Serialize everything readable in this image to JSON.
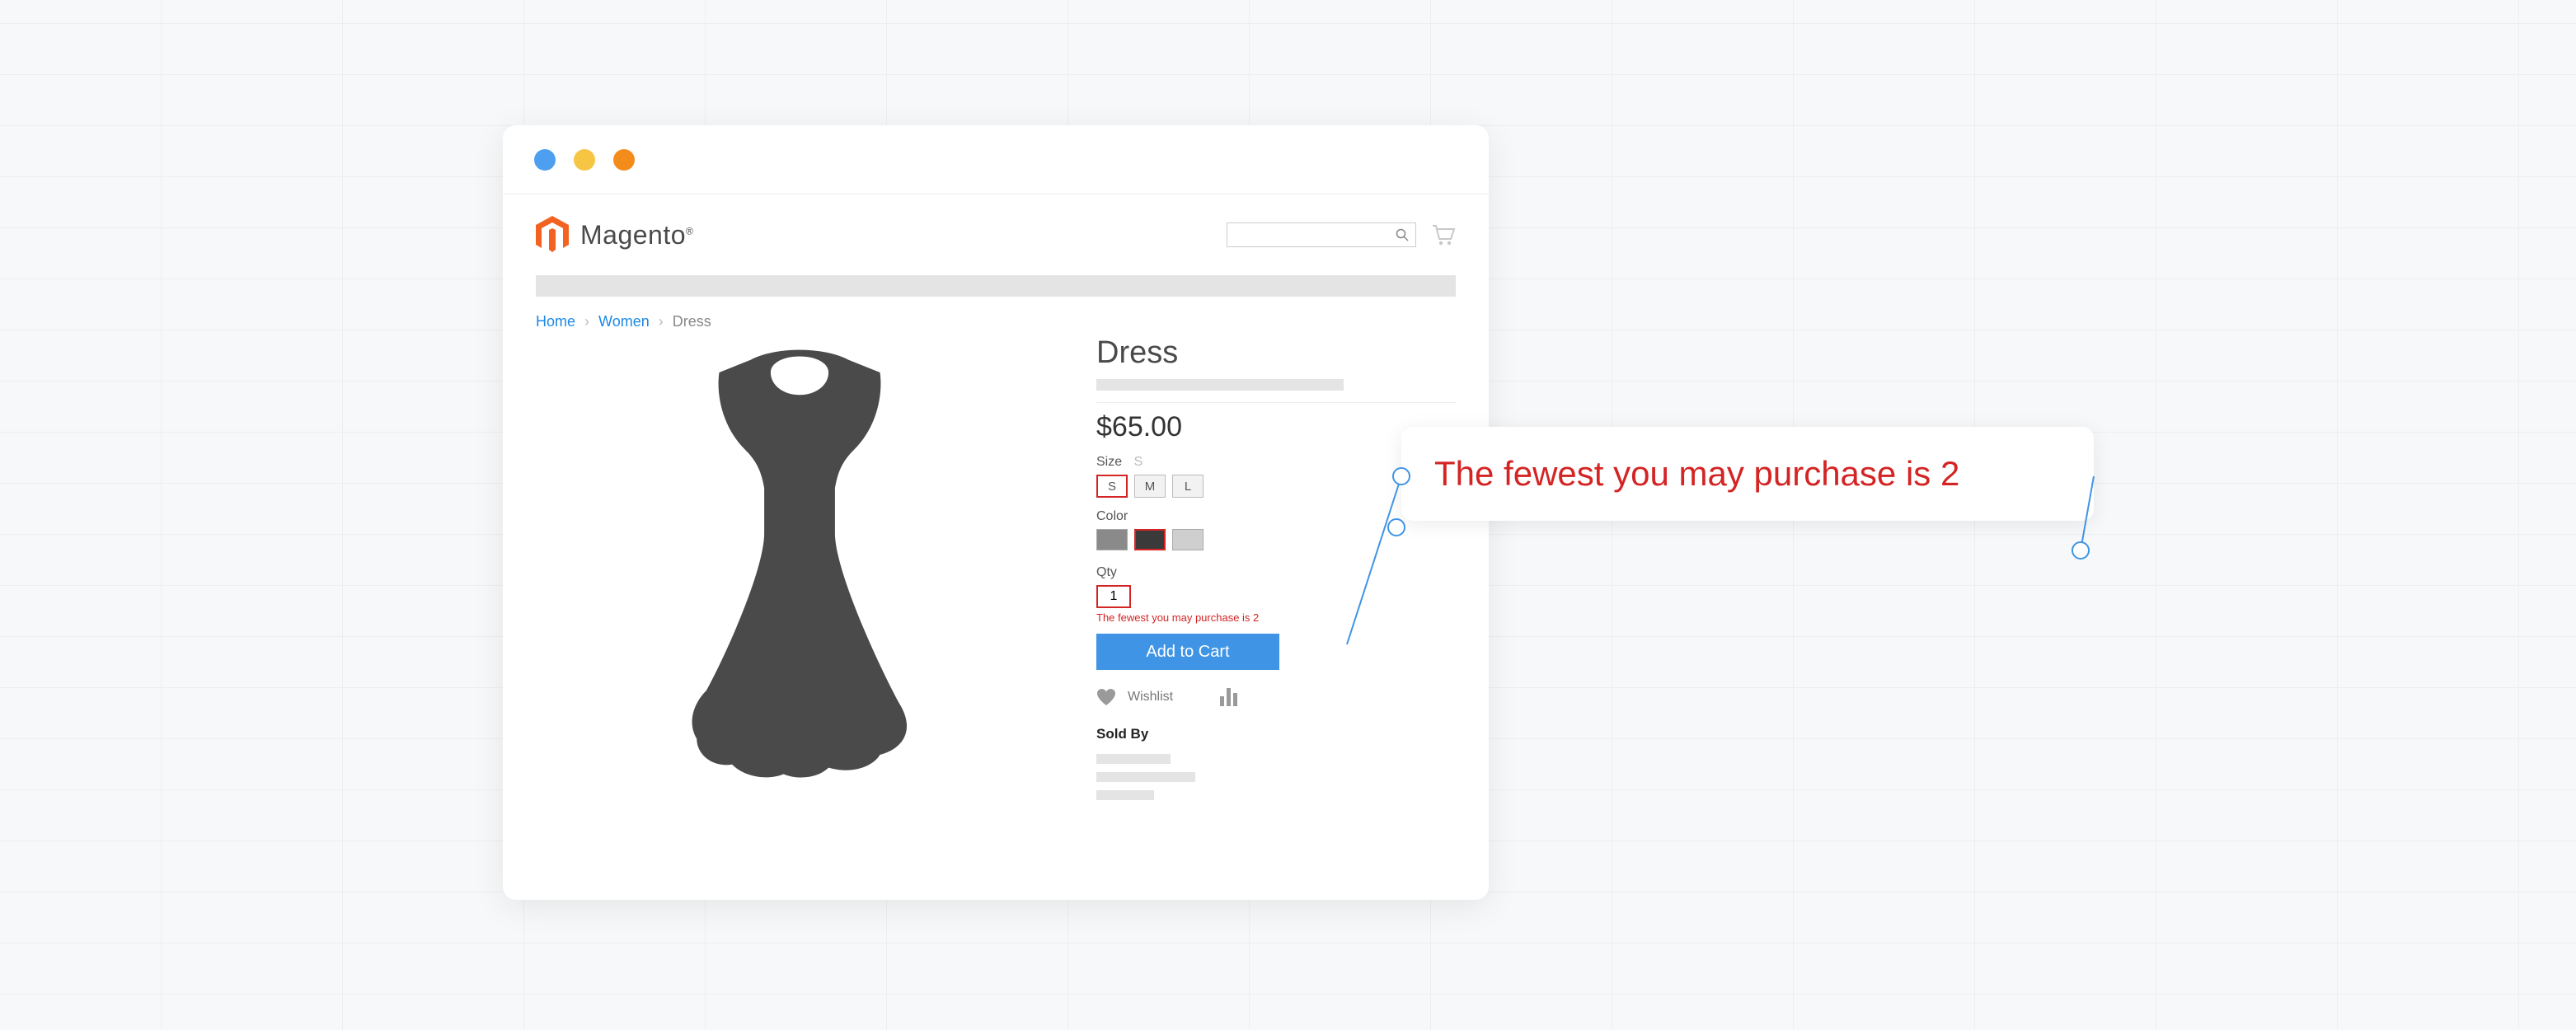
{
  "brand": {
    "name": "Magento"
  },
  "breadcrumbs": {
    "home": "Home",
    "category": "Women",
    "current": "Dress"
  },
  "product": {
    "title": "Dress",
    "price": "$65.00",
    "size": {
      "label": "Size",
      "selected_hint": "S",
      "options": [
        "S",
        "M",
        "L"
      ],
      "selected": "S"
    },
    "color": {
      "label": "Color",
      "options": [
        "#8a8a8a",
        "#3a3a3a",
        "#cfcfcf"
      ],
      "selected_index": 1
    },
    "qty": {
      "label": "Qty",
      "value": "1",
      "error": "The fewest you may purchase is 2"
    },
    "add_to_cart": "Add to Cart",
    "wishlist_label": "Wishlist",
    "sold_by_label": "Sold By"
  },
  "callout": {
    "text": "The fewest you may purchase is 2"
  },
  "colors": {
    "error": "#d42424",
    "link": "#1e88e5",
    "primary_button": "#3f94e5"
  }
}
